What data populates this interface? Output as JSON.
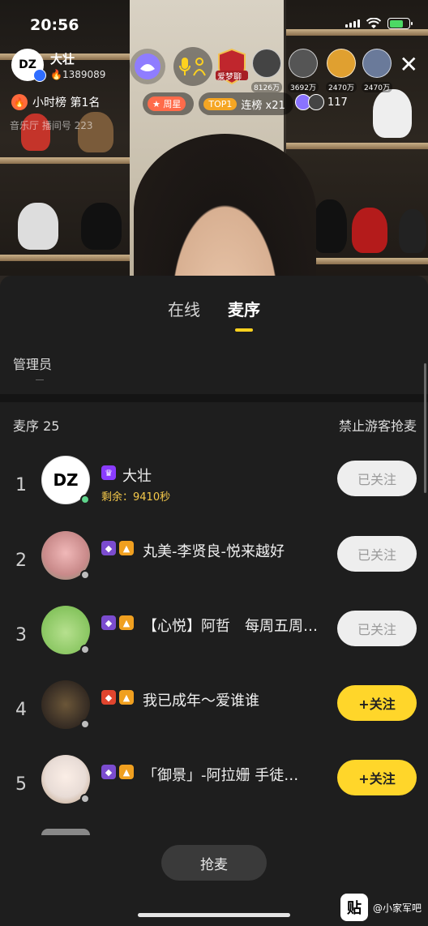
{
  "status_bar": {
    "time": "20:56"
  },
  "host": {
    "name": "大壮",
    "heat": "1389089",
    "avatar_text": "DZ"
  },
  "viewers": [
    {
      "value": "8126万",
      "color": "#444"
    },
    {
      "value": "3692万",
      "color": "#555"
    },
    {
      "value": "2470万",
      "color": "#e0a030"
    },
    {
      "value": "2470万",
      "color": "#6a7a9a"
    }
  ],
  "overlay": {
    "rank_label": "小时榜 第1名",
    "room_id": "音乐厅 播间号 223",
    "tag_week_chip": "周星",
    "tag_top_chip": "TOP1",
    "tag_top_text": "连榜 x21",
    "mini_count": "117",
    "dream_label": "爱梦聊"
  },
  "sheet": {
    "tabs": [
      {
        "label": "在线"
      },
      {
        "label": "麦序"
      }
    ],
    "admin_label": "管理员",
    "queue_title": "麦序 25",
    "ban_guest": "禁止游客抢麦",
    "grab_button": "抢麦"
  },
  "queue": [
    {
      "num": "1",
      "name": "大壮",
      "sub": "剩余：9410秒",
      "follow": "已关注",
      "state": "done",
      "online": "green",
      "avatar_color": "#ffffff",
      "avatar_text": "DZ",
      "badges": [
        "#8a3cff"
      ]
    },
    {
      "num": "2",
      "name": "丸美-李贤良-悦来越好",
      "sub": "",
      "follow": "已关注",
      "state": "done",
      "online": "gray",
      "avatar_color": "#c98a8a",
      "avatar_text": "",
      "badges": [
        "#7b4ccf",
        "#f0a020"
      ]
    },
    {
      "num": "3",
      "name": "【心悦】阿哲　每周五周…",
      "sub": "",
      "follow": "已关注",
      "state": "done",
      "online": "gray",
      "avatar_color": "#9ed27a",
      "avatar_text": "",
      "badges": [
        "#7b4ccf",
        "#f0a020"
      ]
    },
    {
      "num": "4",
      "name": "我已成年～爱谁谁",
      "sub": "",
      "follow": "+关注",
      "state": "add",
      "online": "gray",
      "avatar_color": "#3b3026",
      "avatar_text": "",
      "badges": [
        "#e0452e",
        "#f0a020"
      ]
    },
    {
      "num": "5",
      "name": "「御景」-阿拉姗 手徒…",
      "sub": "",
      "follow": "+关注",
      "state": "add",
      "online": "gray",
      "avatar_color": "#e8dcd6",
      "avatar_text": "",
      "badges": [
        "#7b4ccf",
        "#f0a020"
      ]
    }
  ],
  "watermark": {
    "logo": "贴",
    "text": "@小家军吧"
  }
}
